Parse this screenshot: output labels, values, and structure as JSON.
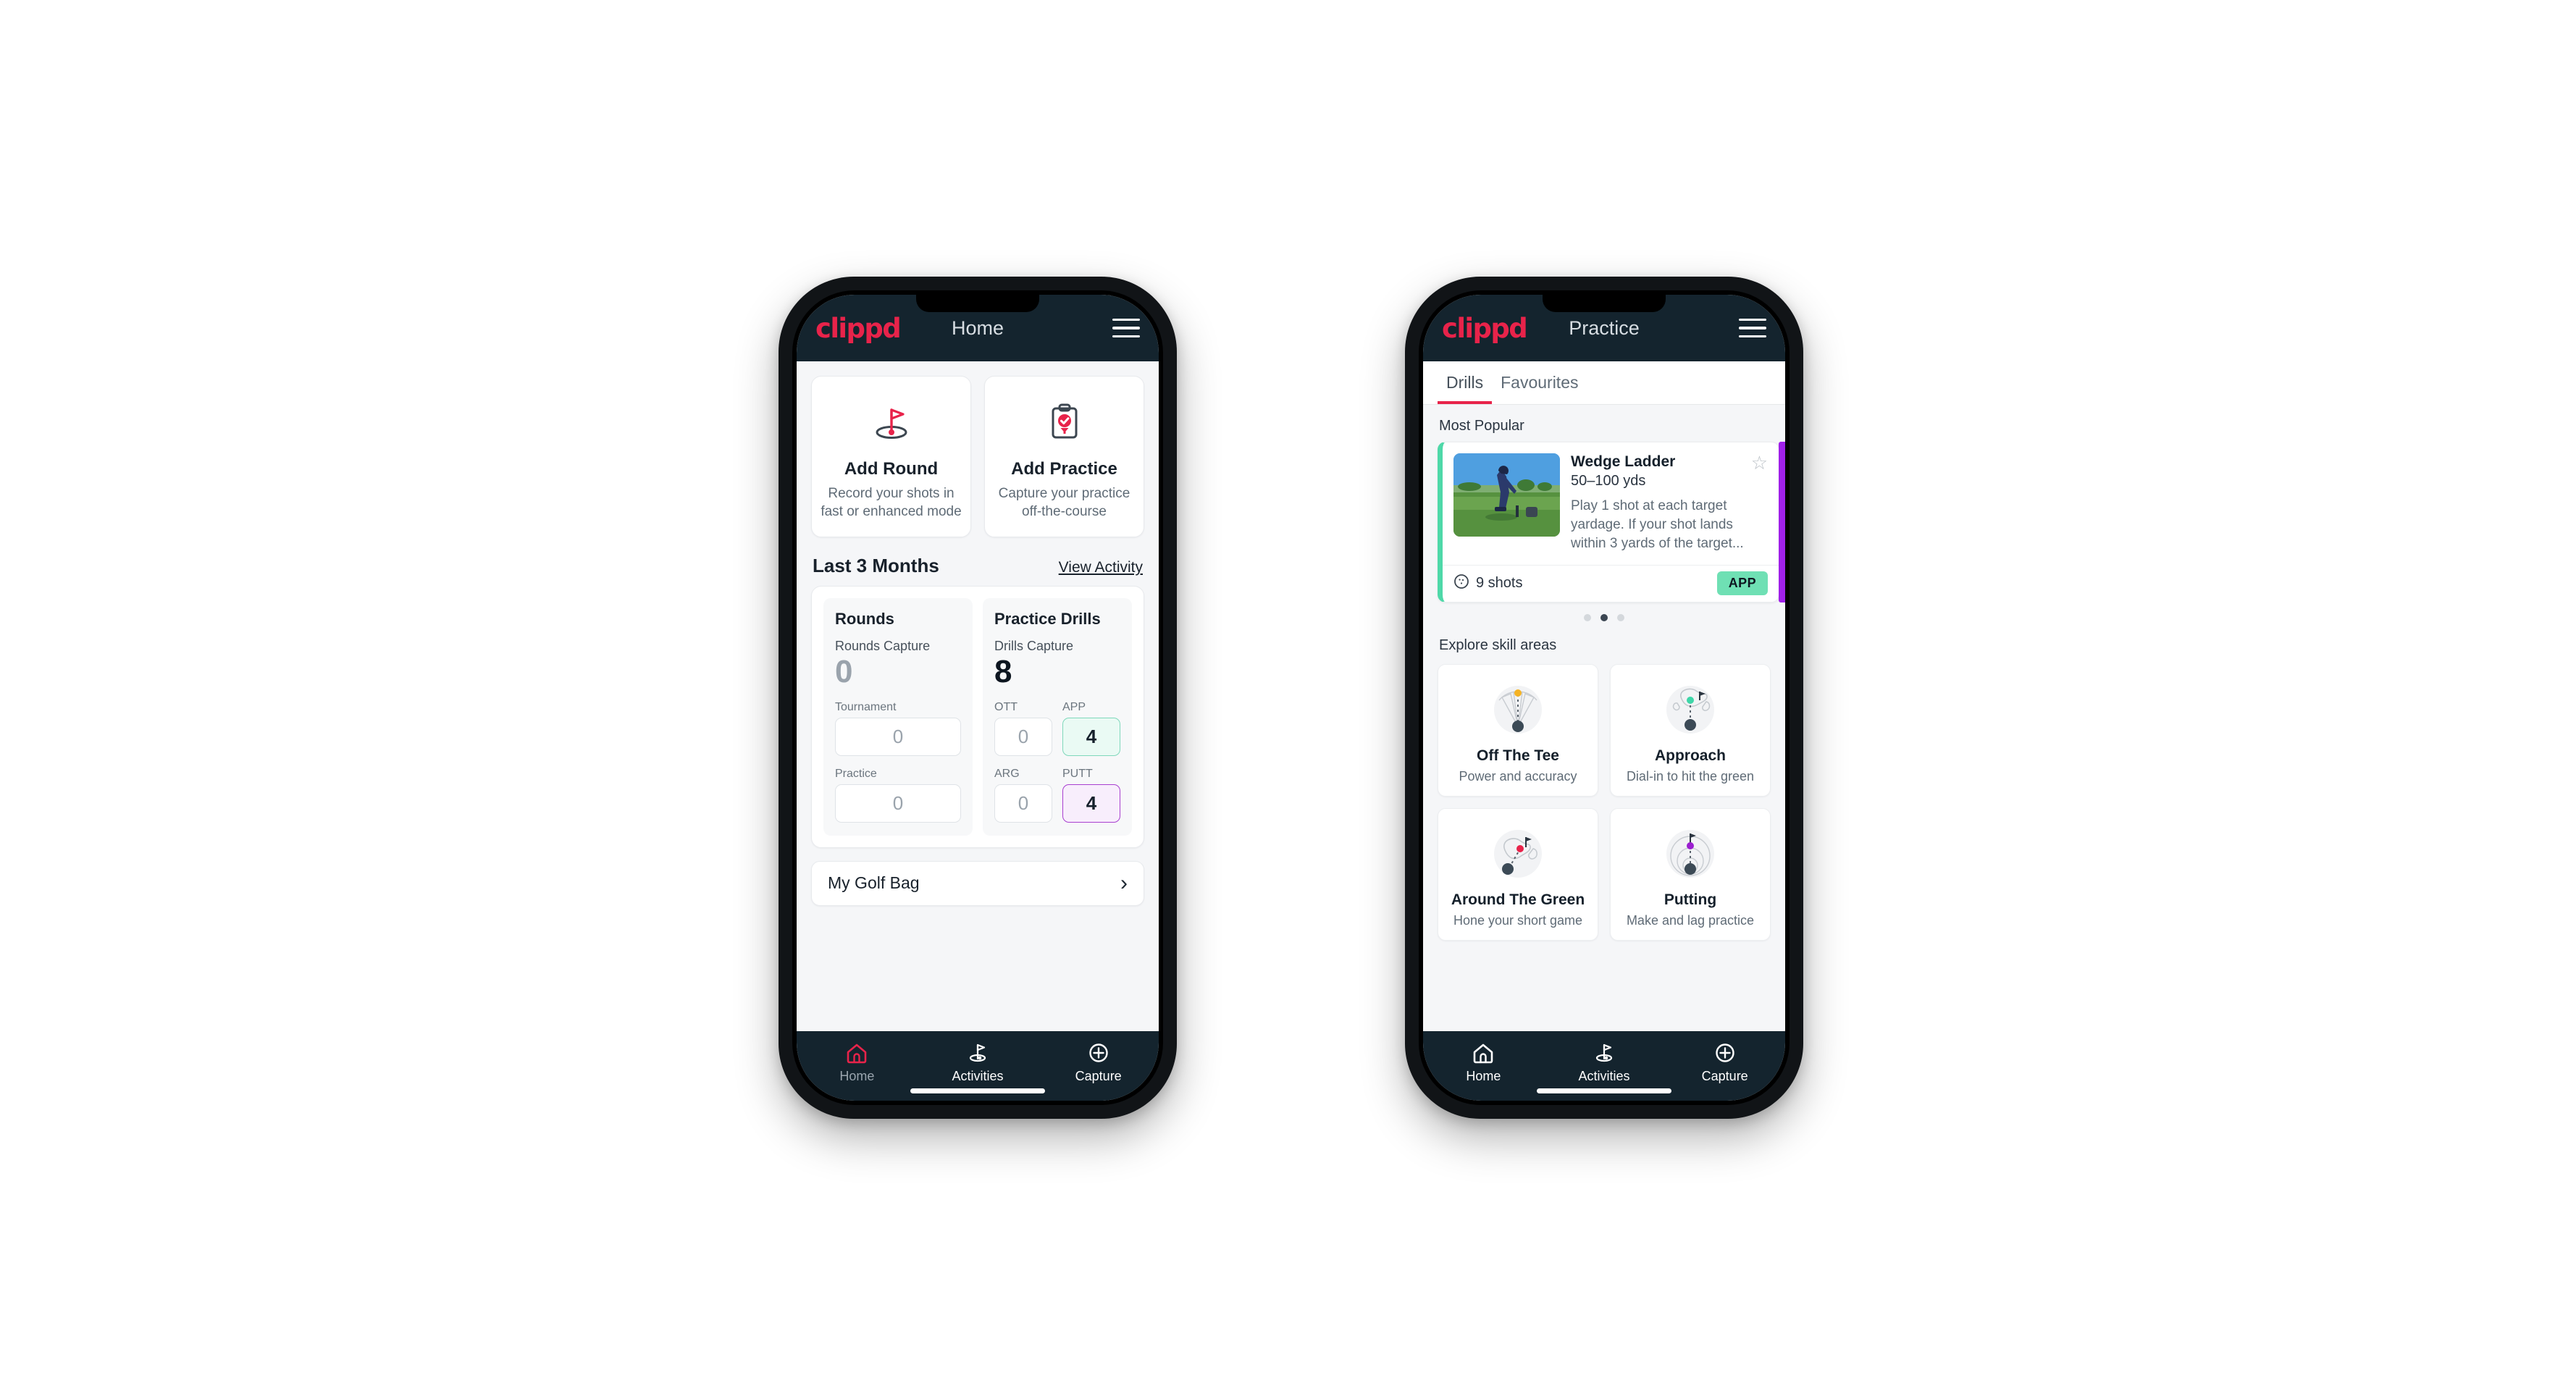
{
  "brand": {
    "name": "clippd",
    "accent": "#e8234a",
    "header_bg": "#14242e"
  },
  "phone_home": {
    "header": {
      "logo": "clippd",
      "title": "Home",
      "menu_icon": "hamburger-icon"
    },
    "quick_actions": [
      {
        "icon": "golf-flag-icon",
        "title": "Add Round",
        "subtitle": "Record your shots in fast or enhanced mode"
      },
      {
        "icon": "clipboard-check-icon",
        "title": "Add Practice",
        "subtitle": "Capture your practice off-the-course"
      }
    ],
    "section": {
      "title": "Last 3 Months",
      "link": "View Activity"
    },
    "rounds": {
      "heading": "Rounds",
      "capture_label": "Rounds Capture",
      "capture_value": "0",
      "fields": [
        {
          "label": "Tournament",
          "value": "0",
          "state": "default"
        },
        {
          "label": "Practice",
          "value": "0",
          "state": "default"
        }
      ]
    },
    "drills": {
      "heading": "Practice Drills",
      "capture_label": "Drills Capture",
      "capture_value": "8",
      "fields": [
        {
          "label": "OTT",
          "value": "0",
          "state": "default"
        },
        {
          "label": "APP",
          "value": "4",
          "state": "app",
          "color": "#7fd8bb"
        },
        {
          "label": "ARG",
          "value": "0",
          "state": "default"
        },
        {
          "label": "PUTT",
          "value": "4",
          "state": "putt",
          "color": "#a83fd0"
        }
      ]
    },
    "golf_bag": {
      "label": "My Golf Bag",
      "chevron": "chevron-right-icon"
    },
    "nav": [
      {
        "icon": "home-icon",
        "label": "Home",
        "active": true
      },
      {
        "icon": "golf-flag-icon",
        "label": "Activities",
        "active": false
      },
      {
        "icon": "plus-circle-icon",
        "label": "Capture",
        "active": false
      }
    ]
  },
  "phone_practice": {
    "header": {
      "logo": "clippd",
      "title": "Practice",
      "menu_icon": "hamburger-icon"
    },
    "tabs": [
      {
        "label": "Drills",
        "active": true
      },
      {
        "label": "Favourites",
        "active": false
      }
    ],
    "most_popular_label": "Most Popular",
    "drill_card": {
      "name": "Wedge Ladder",
      "yardage": "50–100 yds",
      "description": "Play 1 shot at each target yardage. If your shot lands within 3 yards of the target...",
      "shots": "9 shots",
      "shots_icon": "golf-ball-icon",
      "badge": "APP",
      "badge_color": "#6fe0b4",
      "accent_color": "#4ed8a8",
      "favourite_icon": "star-outline-icon",
      "next_card_accent": "#a020e8"
    },
    "carousel": {
      "count": 3,
      "active_index": 1
    },
    "skill_label": "Explore skill areas",
    "skills": [
      {
        "icon": "tee-fan-icon",
        "name": "Off The Tee",
        "subtitle": "Power and accuracy",
        "dot_color": "#f5b325"
      },
      {
        "icon": "approach-green-icon",
        "name": "Approach",
        "subtitle": "Dial-in to hit the green",
        "dot_color": "#3ed6a8"
      },
      {
        "icon": "chip-green-icon",
        "name": "Around The Green",
        "subtitle": "Hone your short game",
        "dot_color": "#e8234a"
      },
      {
        "icon": "putting-rings-icon",
        "name": "Putting",
        "subtitle": "Make and lag practice",
        "dot_color": "#9b1fd0"
      }
    ],
    "nav": [
      {
        "icon": "home-icon",
        "label": "Home",
        "active": false
      },
      {
        "icon": "golf-flag-icon",
        "label": "Activities",
        "active": false
      },
      {
        "icon": "plus-circle-icon",
        "label": "Capture",
        "active": false
      }
    ]
  }
}
